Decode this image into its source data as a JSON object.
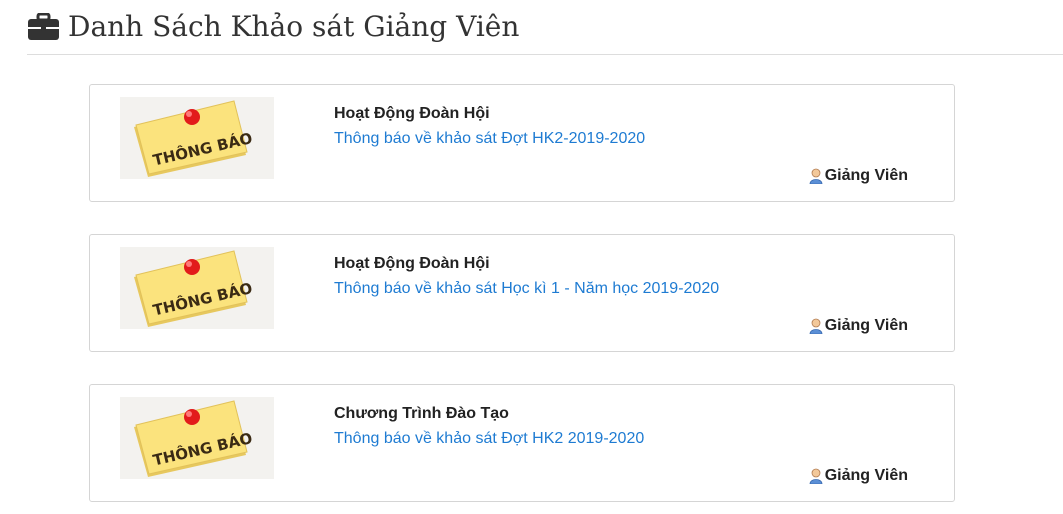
{
  "page": {
    "title": "Danh Sách Khảo sát Giảng Viên",
    "title_icon": "briefcase-icon"
  },
  "thumbnail": {
    "text": "THÔNG BÁO",
    "icon": "notice-pin-icon",
    "note_color": "#fbe37d",
    "pin_color": "#e21b1b"
  },
  "surveys": [
    {
      "category": "Hoạt Động Đoàn Hội",
      "link": "Thông báo về khảo sát Đợt HK2-2019-2020",
      "role": "Giảng Viên"
    },
    {
      "category": "Hoạt Động Đoàn Hội",
      "link": "Thông báo về khảo sát Học kì 1 - Năm học 2019-2020",
      "role": "Giảng Viên"
    },
    {
      "category": "Chương Trình Đào Tạo",
      "link": "Thông báo về khảo sát Đợt HK2 2019-2020",
      "role": "Giảng Viên"
    }
  ],
  "colors": {
    "link": "#1e7bd2",
    "border": "#d5d5d5"
  }
}
